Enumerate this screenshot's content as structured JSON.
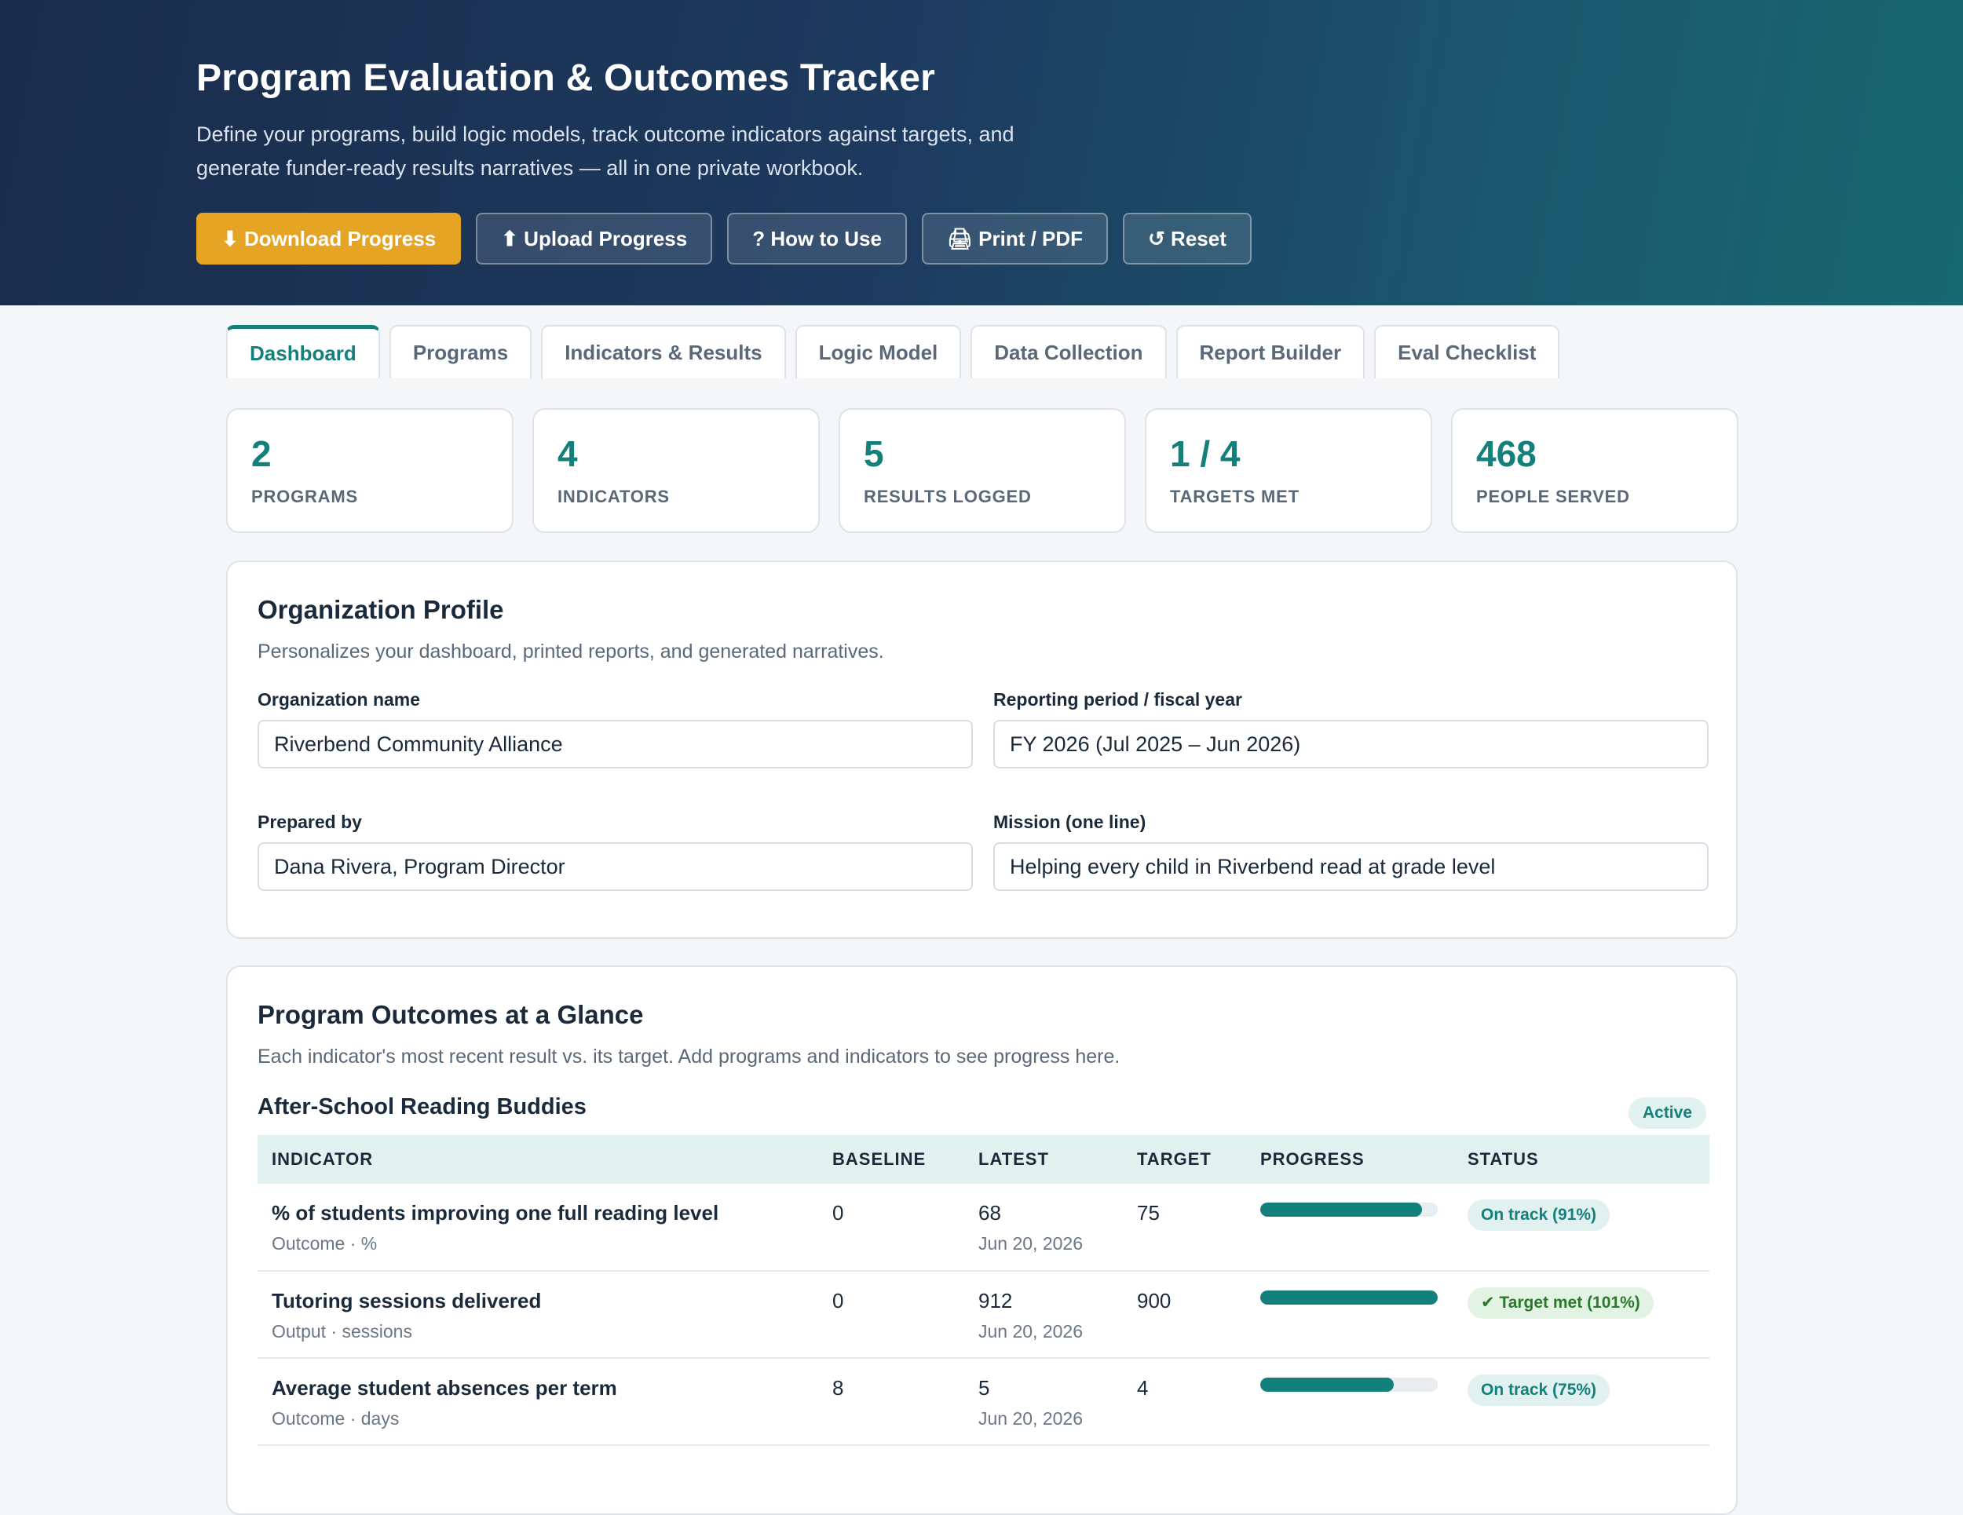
{
  "header": {
    "title": "Program Evaluation & Outcomes Tracker",
    "subtitle_line1": "Define your programs, build logic models, track outcome indicators against targets, and",
    "subtitle_line2": "generate funder-ready results narratives — all in one private workbook.",
    "buttons": {
      "download": "⬇ Download Progress",
      "upload": "⬆ Upload Progress",
      "how": "? How to Use",
      "print": "🖨 Print / PDF",
      "reset": "↺ Reset"
    }
  },
  "tabs": [
    "Dashboard",
    "Programs",
    "Indicators & Results",
    "Logic Model",
    "Data Collection",
    "Report Builder",
    "Eval Checklist"
  ],
  "stats": [
    {
      "value": "2",
      "label": "PROGRAMS"
    },
    {
      "value": "4",
      "label": "INDICATORS"
    },
    {
      "value": "5",
      "label": "RESULTS LOGGED"
    },
    {
      "value": "1 / 4",
      "label": "TARGETS MET"
    },
    {
      "value": "468",
      "label": "PEOPLE SERVED"
    }
  ],
  "profile": {
    "title": "Organization Profile",
    "subtitle": "Personalizes your dashboard, printed reports, and generated narratives.",
    "org_label": "Organization name",
    "org_value": "Riverbend Community Alliance",
    "period_label": "Reporting period / fiscal year",
    "period_value": "FY 2026 (Jul 2025 – Jun 2026)",
    "prepared_label": "Prepared by",
    "prepared_value": "Dana Rivera, Program Director",
    "mission_label": "Mission (one line)",
    "mission_value": "Helping every child in Riverbend read at grade level"
  },
  "outcomes": {
    "title": "Program Outcomes at a Glance",
    "subtitle": "Each indicator's most recent result vs. its target. Add programs and indicators to see progress here.",
    "program": "After-School Reading Buddies",
    "program_status": "Active",
    "columns": [
      "INDICATOR",
      "BASELINE",
      "LATEST",
      "TARGET",
      "PROGRESS",
      "STATUS"
    ],
    "rows": [
      {
        "name": "% of students improving one full reading level",
        "meta": "Outcome · %",
        "baseline": "0",
        "latest": "68",
        "date": "Jun 20, 2026",
        "target": "75",
        "progress": 0.91,
        "status": "On track (91%)",
        "status_type": "track"
      },
      {
        "name": "Tutoring sessions delivered",
        "meta": "Output · sessions",
        "baseline": "0",
        "latest": "912",
        "date": "Jun 20, 2026",
        "target": "900",
        "progress": 1.0,
        "status": "✔ Target met (101%)",
        "status_type": "met"
      },
      {
        "name": "Average student absences per term",
        "meta": "Outcome · days",
        "baseline": "8",
        "latest": "5",
        "date": "Jun 20, 2026",
        "target": "4",
        "progress": 0.75,
        "status": "On track (75%)",
        "status_type": "track"
      }
    ]
  },
  "colors": {
    "accent": "#14807c",
    "primary_button": "#e6a425",
    "header_start": "#1a2c4b",
    "header_end": "#17686f"
  }
}
